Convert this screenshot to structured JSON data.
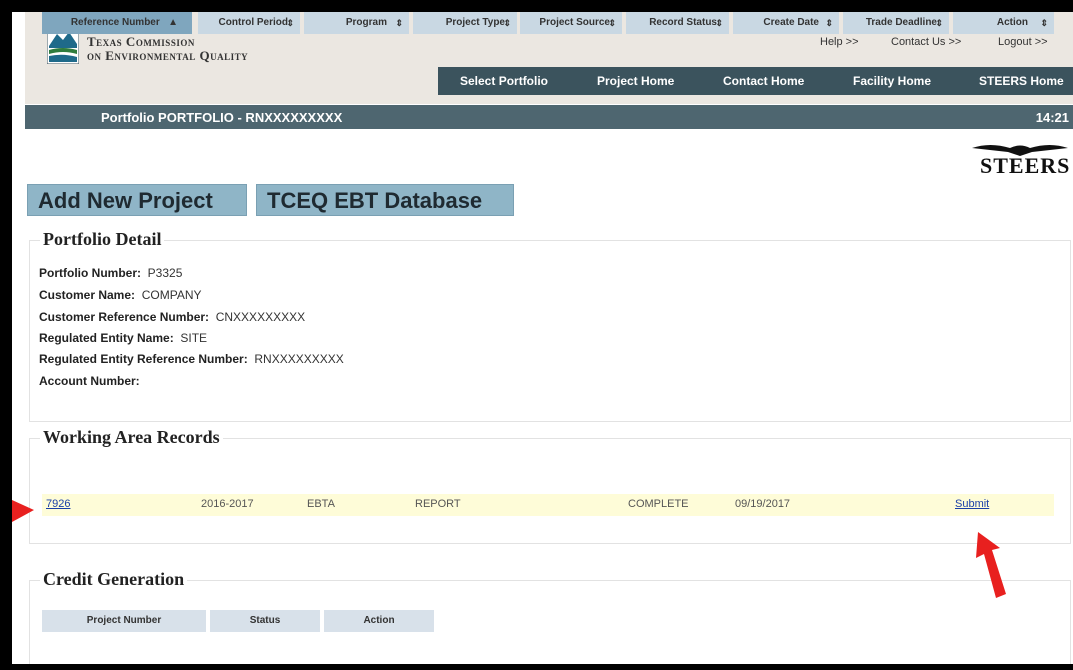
{
  "header": {
    "org_line1": "Texas Commission",
    "org_line2": "on Environmental Quality",
    "help": "Help >>",
    "contact": "Contact Us >>",
    "logout": "Logout >>"
  },
  "nav": [
    "Select Portfolio",
    "Project Home",
    "Contact Home",
    "Facility Home",
    "STEERS Home"
  ],
  "portfolio_bar": {
    "title": "Portfolio PORTFOLIO - RNXXXXXXXXX",
    "time": "14:21"
  },
  "steers_logo": "STEERS",
  "buttons": {
    "add_project": "Add New Project",
    "ebt_database": "TCEQ EBT Database"
  },
  "portfolio_detail": {
    "title": "Portfolio Detail",
    "fields": [
      {
        "label": "Portfolio Number:",
        "value": "P3325"
      },
      {
        "label": "Customer Name:",
        "value": "COMPANY"
      },
      {
        "label": "Customer Reference Number:",
        "value": "CNXXXXXXXXX"
      },
      {
        "label": "Regulated Entity Name:",
        "value": "SITE"
      },
      {
        "label": "Regulated Entity Reference Number:",
        "value": "RNXXXXXXXXX"
      },
      {
        "label": "Account Number:",
        "value": ""
      }
    ]
  },
  "working_area": {
    "title": "Working Area Records",
    "columns": [
      "Reference Number",
      "Control Period",
      "Program",
      "Project Type",
      "Project Source",
      "Record Status",
      "Create Date",
      "Trade Deadline",
      "Action"
    ],
    "rows": [
      {
        "reference": "7926",
        "control_period": "2016-2017",
        "program": "EBTA",
        "project_type": "REPORT",
        "project_source": "",
        "record_status": "COMPLETE",
        "create_date": "09/19/2017",
        "trade_deadline": "",
        "action": "Submit"
      }
    ]
  },
  "credit_generation": {
    "title": "Credit Generation",
    "columns": [
      "Project Number",
      "Status",
      "Action"
    ]
  },
  "colors": {
    "nav_bg": "#3b535d",
    "header_bg": "#ebe7e1",
    "button_bg": "#8fb5c7",
    "row_highlight": "#fefcd8",
    "arrow": "#e8201f"
  }
}
